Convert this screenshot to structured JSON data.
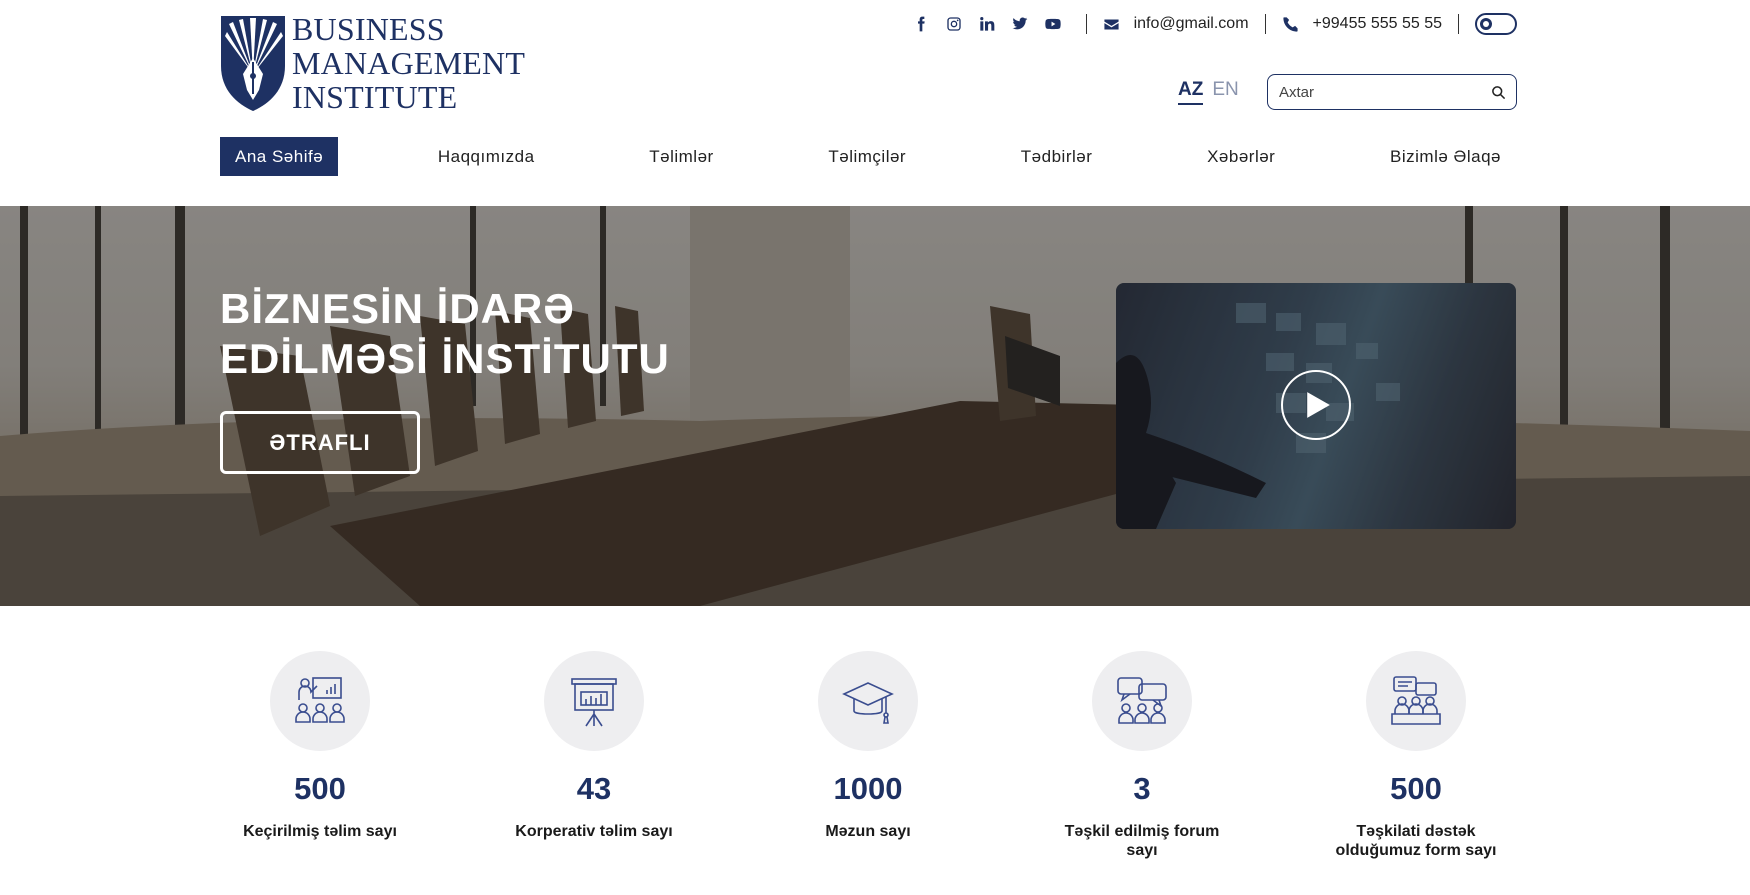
{
  "brand": {
    "line1": "BUSINESS",
    "line2": "MANAGEMENT",
    "line3": "INSTITUTE",
    "color": "#1e3163"
  },
  "topbar": {
    "social_icons": [
      "facebook-icon",
      "instagram-icon",
      "linkedin-icon",
      "twitter-icon",
      "youtube-icon"
    ],
    "email": "info@gmail.com",
    "phone": "+99455 555 55 55"
  },
  "language": {
    "active": "AZ",
    "other": "EN"
  },
  "search": {
    "placeholder": "Axtar"
  },
  "nav": {
    "items": [
      {
        "label": "Ana Səhifə",
        "active": true
      },
      {
        "label": "Haqqımızda"
      },
      {
        "label": "Təlimlər"
      },
      {
        "label": "Təlimçilər"
      },
      {
        "label": "Tədbirlər"
      },
      {
        "label": "Xəbərlər"
      },
      {
        "label": "Bizimlə Əlaqə"
      }
    ]
  },
  "hero": {
    "title_line1": "BİZNESİN İDARƏ",
    "title_line2": "EDİLMƏSİ İNSTİTUTU",
    "button": "ƏTRAFLI"
  },
  "stats": [
    {
      "icon": "presentation-audience-icon",
      "value": "500",
      "label": "Keçirilmiş təlim sayı"
    },
    {
      "icon": "chart-board-icon",
      "value": "43",
      "label": "Korperativ təlim sayı"
    },
    {
      "icon": "graduation-cap-icon",
      "value": "1000",
      "label": "Məzun sayı"
    },
    {
      "icon": "forum-chat-icon",
      "value": "3",
      "label": "Təşkil edilmiş forum sayı"
    },
    {
      "icon": "support-meeting-icon",
      "value": "500",
      "label": "Təşkilati dəstək olduğumuz form sayı"
    }
  ]
}
